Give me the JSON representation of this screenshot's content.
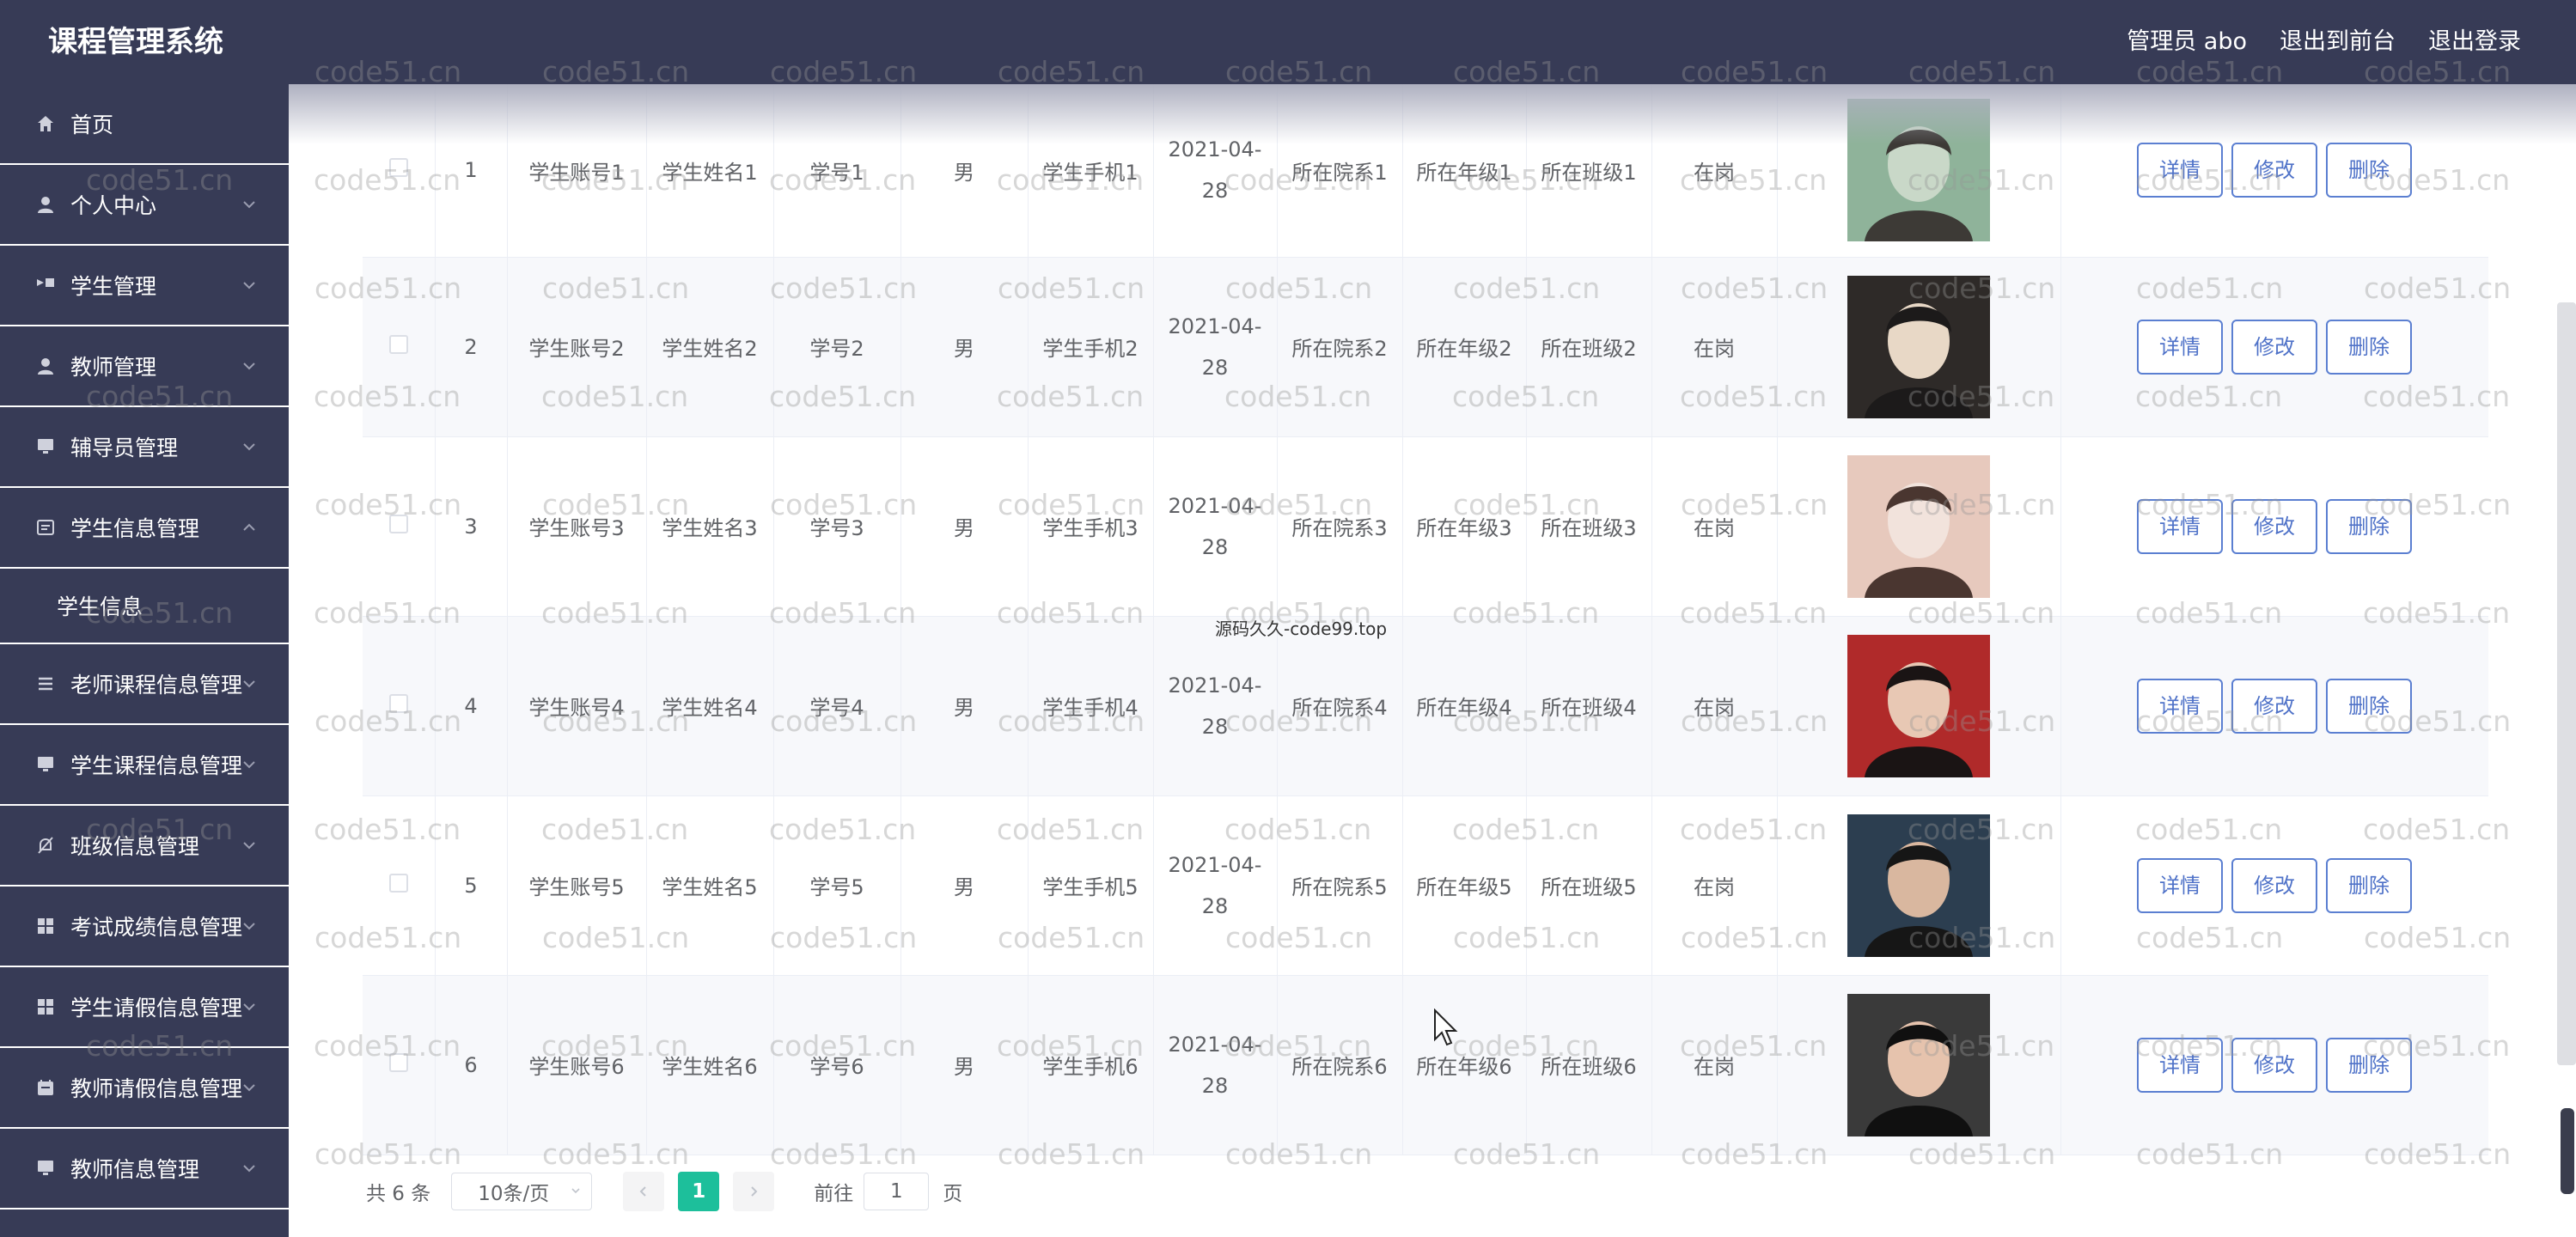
{
  "app": {
    "title": "课程管理系统"
  },
  "header": {
    "user": "管理员 abo",
    "frontend": "退出到前台",
    "logout": "退出登录"
  },
  "sidebar": {
    "home": "首页",
    "items": [
      {
        "label": "个人中心",
        "icon": "user-icon"
      },
      {
        "label": "学生管理",
        "icon": "flag-icon"
      },
      {
        "label": "教师管理",
        "icon": "user-icon"
      },
      {
        "label": "辅导员管理",
        "icon": "monitor-icon"
      },
      {
        "label": "学生信息管理",
        "icon": "list-icon"
      },
      {
        "label": "老师课程信息管理",
        "icon": "menu-icon"
      },
      {
        "label": "学生课程信息管理",
        "icon": "monitor-icon"
      },
      {
        "label": "班级信息管理",
        "icon": "bell-off-icon"
      },
      {
        "label": "考试成绩信息管理",
        "icon": "grid-icon"
      },
      {
        "label": "学生请假信息管理",
        "icon": "grid-icon"
      },
      {
        "label": "教师请假信息管理",
        "icon": "calendar-icon"
      },
      {
        "label": "教师信息管理",
        "icon": "monitor-icon"
      }
    ],
    "expanded_sub": "学生信息"
  },
  "table": {
    "rows": [
      {
        "index": "1",
        "account": "学生账号1",
        "name": "学生姓名1",
        "student_no": "学号1",
        "gender": "男",
        "phone": "学生手机1",
        "date_line1": "2021-04-",
        "date_line2": "28",
        "department": "所在院系1",
        "grade": "所在年级1",
        "class": "所在班级1",
        "status": "在岗"
      },
      {
        "index": "2",
        "account": "学生账号2",
        "name": "学生姓名2",
        "student_no": "学号2",
        "gender": "男",
        "phone": "学生手机2",
        "date_line1": "2021-04-",
        "date_line2": "28",
        "department": "所在院系2",
        "grade": "所在年级2",
        "class": "所在班级2",
        "status": "在岗"
      },
      {
        "index": "3",
        "account": "学生账号3",
        "name": "学生姓名3",
        "student_no": "学号3",
        "gender": "男",
        "phone": "学生手机3",
        "date_line1": "2021-04-",
        "date_line2": "28",
        "department": "所在院系3",
        "grade": "所在年级3",
        "class": "所在班级3",
        "status": "在岗"
      },
      {
        "index": "4",
        "account": "学生账号4",
        "name": "学生姓名4",
        "student_no": "学号4",
        "gender": "男",
        "phone": "学生手机4",
        "date_line1": "2021-04-",
        "date_line2": "28",
        "department": "所在院系4",
        "grade": "所在年级4",
        "class": "所在班级4",
        "status": "在岗"
      },
      {
        "index": "5",
        "account": "学生账号5",
        "name": "学生姓名5",
        "student_no": "学号5",
        "gender": "男",
        "phone": "学生手机5",
        "date_line1": "2021-04-",
        "date_line2": "28",
        "department": "所在院系5",
        "grade": "所在年级5",
        "class": "所在班级5",
        "status": "在岗"
      },
      {
        "index": "6",
        "account": "学生账号6",
        "name": "学生姓名6",
        "student_no": "学号6",
        "gender": "男",
        "phone": "学生手机6",
        "date_line1": "2021-04-",
        "date_line2": "28",
        "department": "所在院系6",
        "grade": "所在年级6",
        "class": "所在班级6",
        "status": "在岗"
      }
    ],
    "actions": {
      "detail": "详情",
      "edit": "修改",
      "delete": "删除"
    }
  },
  "pagination": {
    "total": "共 6 条",
    "page_size": "10条/页",
    "current": "1",
    "goto": "前往",
    "goto_value": "1",
    "page_unit": "页"
  },
  "watermark": "code51.cn",
  "center_watermark": "源码久久-code99.top",
  "colors": {
    "header_bg": "#373b56",
    "accent": "#1dbf9b",
    "button_border": "#5b7fd1"
  }
}
